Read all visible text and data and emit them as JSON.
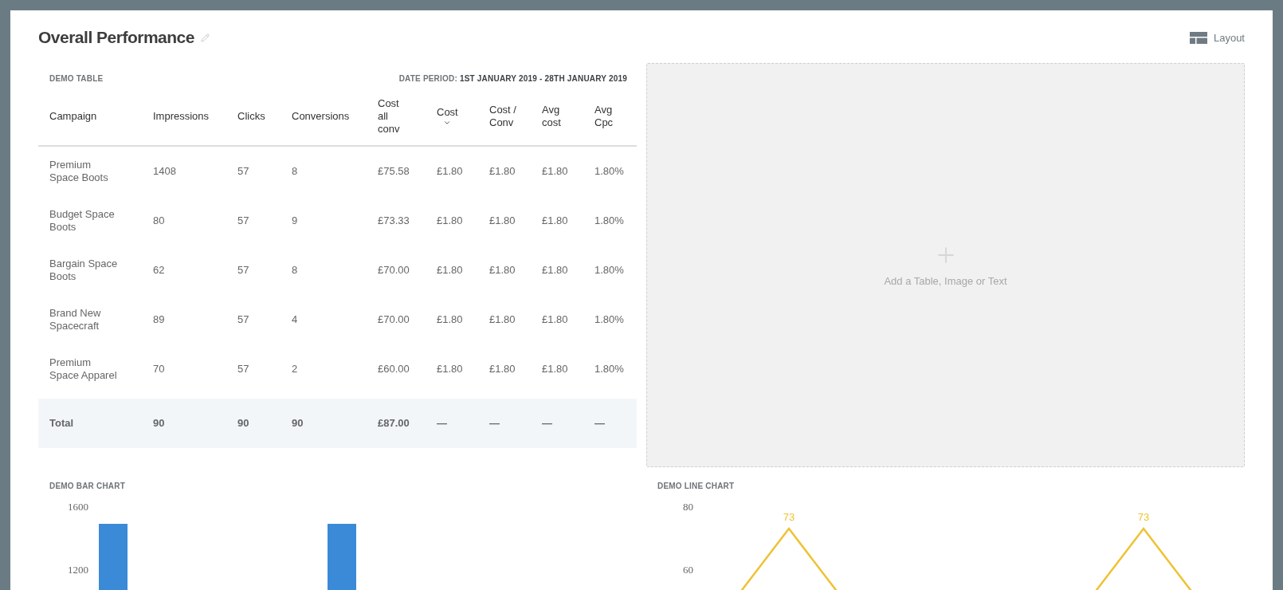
{
  "page": {
    "title": "Overall Performance",
    "layout_button": "Layout"
  },
  "table": {
    "title": "DEMO TABLE",
    "period_label": "DATE PERIOD:",
    "period_value": "1ST JANUARY 2019 - 28TH JANUARY 2019",
    "columns": [
      {
        "label": "Campaign",
        "sorted": false
      },
      {
        "label": "Impressions",
        "sorted": false
      },
      {
        "label": "Clicks",
        "sorted": false
      },
      {
        "label": "Conversions",
        "sorted": false
      },
      {
        "label": "Cost all conv",
        "sorted": false
      },
      {
        "label": "Cost",
        "sorted": true
      },
      {
        "label": "Cost / Conv",
        "sorted": false
      },
      {
        "label": "Avg cost",
        "sorted": false
      },
      {
        "label": "Avg Cpc",
        "sorted": false
      }
    ],
    "rows": [
      [
        "Premium Space Boots",
        "1408",
        "57",
        "8",
        "£75.58",
        "£1.80",
        "£1.80",
        "£1.80",
        "1.80%"
      ],
      [
        "Budget Space Boots",
        "80",
        "57",
        "9",
        "£73.33",
        "£1.80",
        "£1.80",
        "£1.80",
        "1.80%"
      ],
      [
        "Bargain Space Boots",
        "62",
        "57",
        "8",
        "£70.00",
        "£1.80",
        "£1.80",
        "£1.80",
        "1.80%"
      ],
      [
        "Brand New Spacecraft",
        "89",
        "57",
        "4",
        "£70.00",
        "£1.80",
        "£1.80",
        "£1.80",
        "1.80%"
      ],
      [
        "Premium Space Apparel",
        "70",
        "57",
        "2",
        "£60.00",
        "£1.80",
        "£1.80",
        "£1.80",
        "1.80%"
      ]
    ],
    "total": [
      "Total",
      "90",
      "90",
      "90",
      "£87.00",
      "—",
      "—",
      "—",
      "—"
    ]
  },
  "placeholder": {
    "text": "Add a Table, Image or Text"
  },
  "bar_chart": {
    "title": "DEMO BAR CHART",
    "axis_labels": [
      "1600",
      "1200"
    ]
  },
  "line_chart": {
    "title": "DEMO LINE CHART",
    "axis_labels": [
      "80",
      "60"
    ],
    "point_labels": [
      "73",
      "73"
    ]
  }
}
